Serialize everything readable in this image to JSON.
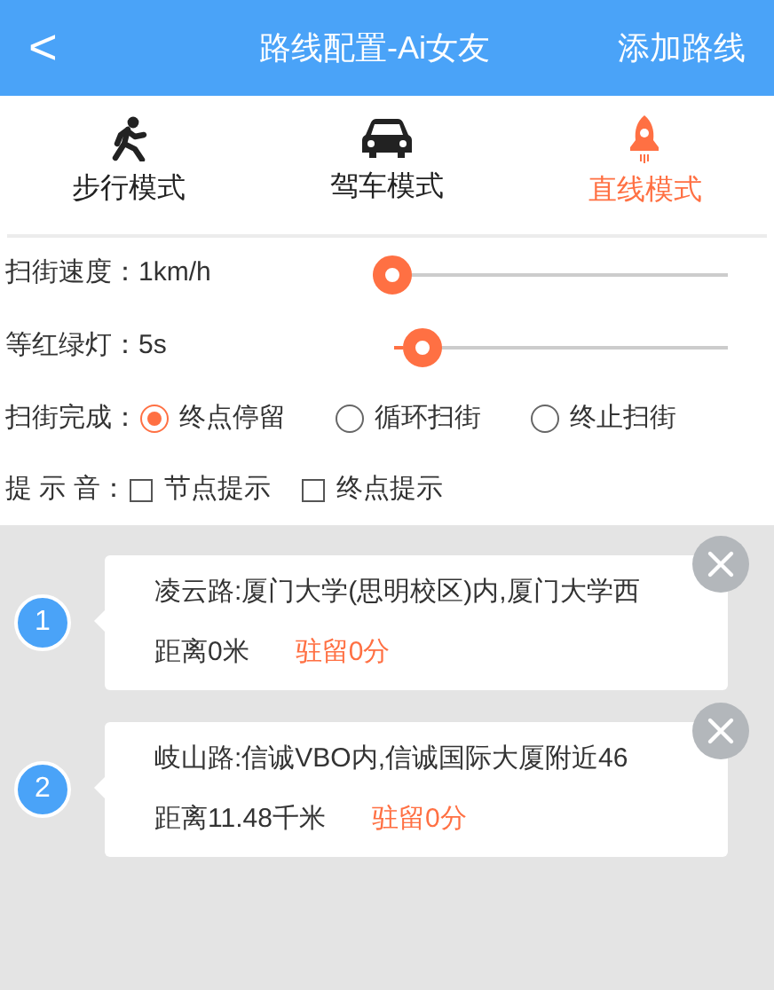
{
  "header": {
    "back": "<",
    "title": "路线配置-Ai女友",
    "action": "添加路线"
  },
  "modes": [
    {
      "kind": "walk",
      "label": "步行模式",
      "selected": false
    },
    {
      "kind": "car",
      "label": "驾车模式",
      "selected": false
    },
    {
      "kind": "rocket",
      "label": "直线模式",
      "selected": true
    }
  ],
  "sliders": [
    {
      "label": "扫街速度：",
      "reading": "1km/h",
      "level": 0
    },
    {
      "label": "等红绿灯：",
      "reading": "5s",
      "level": 0.03
    }
  ],
  "finish": {
    "label": "扫街完成：",
    "options": [
      {
        "label": "终点停留",
        "selected": true
      },
      {
        "label": "循环扫街",
        "selected": false
      },
      {
        "label": "终止扫街",
        "selected": false
      }
    ]
  },
  "sound": {
    "label": "提 示 音：",
    "options": [
      {
        "label": "节点提示",
        "checked": false
      },
      {
        "label": "终点提示",
        "checked": false
      }
    ]
  },
  "stops": [
    {
      "number": "1",
      "address": "凌云路:厦门大学(思明校区)内,厦门大学西",
      "distance": "距离0米",
      "stay": "驻留0分"
    },
    {
      "number": "2",
      "address": "岐山路:信诚VBO内,信诚国际大厦附近46",
      "distance": "距离11.48千米",
      "stay": "驻留0分"
    }
  ]
}
